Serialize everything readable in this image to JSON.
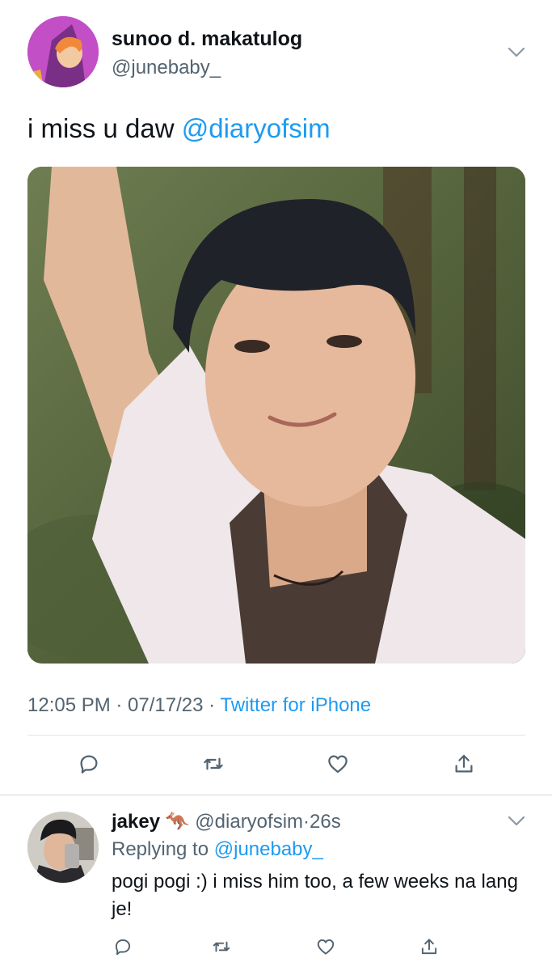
{
  "tweet": {
    "display_name": "sunoo d. makatulog",
    "handle": "@junebaby_",
    "text": "i miss u daw ",
    "mention": "@diaryofsim",
    "time": "12:05 PM · 07/17/23 · ",
    "source": "Twitter for iPhone"
  },
  "reply": {
    "display_name": "jakey",
    "emoji": "🦘",
    "handle": "@diaryofsim",
    "time": "26s",
    "replying_label": "Replying to ",
    "replying_to": "@junebaby_",
    "text": "pogi pogi :) i miss him too, a few weeks na lang je!"
  },
  "icons": {
    "reply": "reply-icon",
    "retweet": "retweet-icon",
    "like": "like-icon",
    "share": "share-icon",
    "more": "chevron-down-icon"
  },
  "colors": {
    "accent": "#1d9bf0",
    "secondary_text": "#536471",
    "primary_text": "#0f1419"
  }
}
